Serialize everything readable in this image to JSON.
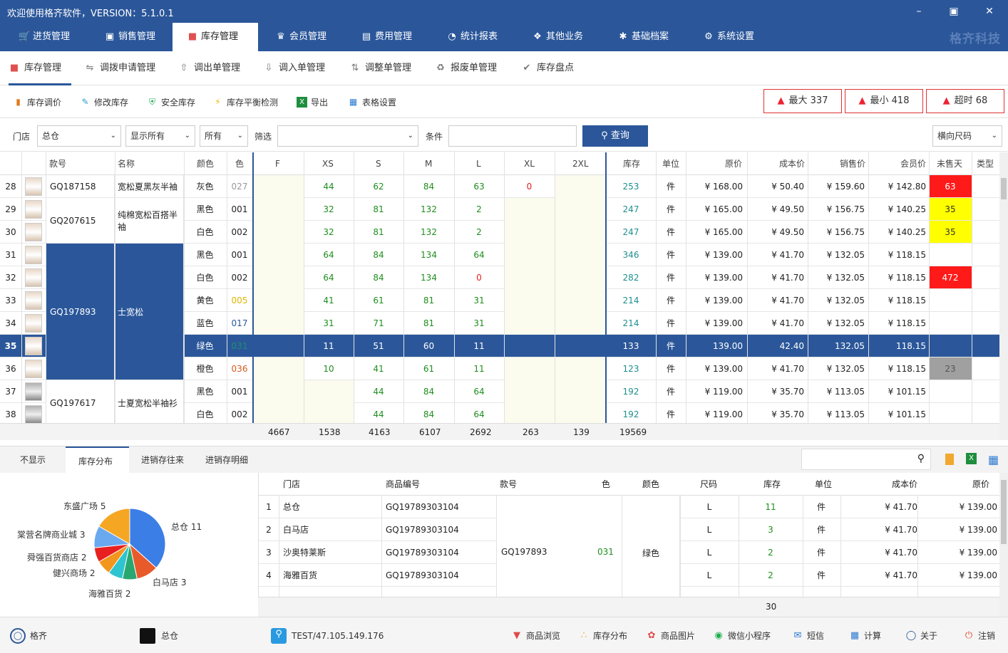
{
  "titlebar": {
    "title": "欢迎使用格齐软件，VERSION：5.1.0.1"
  },
  "menu": {
    "tabs": [
      {
        "label": "进货管理",
        "icon": "cart-icon"
      },
      {
        "label": "销售管理",
        "icon": "bag-icon"
      },
      {
        "label": "库存管理",
        "icon": "box-icon"
      },
      {
        "label": "会员管理",
        "icon": "crown-icon"
      },
      {
        "label": "费用管理",
        "icon": "wallet-icon"
      },
      {
        "label": "统计报表",
        "icon": "pie-icon"
      },
      {
        "label": "其他业务",
        "icon": "apps-icon"
      },
      {
        "label": "基础档案",
        "icon": "puzzle-icon"
      },
      {
        "label": "系统设置",
        "icon": "gear-icon"
      }
    ],
    "brand": "格齐科技"
  },
  "subnav": {
    "tabs": [
      "库存管理",
      "调拨申请管理",
      "调出单管理",
      "调入单管理",
      "调整单管理",
      "报废单管理",
      "库存盘点"
    ]
  },
  "toolbar": {
    "items": [
      "库存调价",
      "修改库存",
      "安全库存",
      "库存平衡检测",
      "导出",
      "表格设置"
    ]
  },
  "alerts": {
    "max": "最大 337",
    "min": "最小 418",
    "overtime": "超时 68"
  },
  "filters": {
    "store_label": "门店",
    "store": "总仓",
    "display": "显示所有",
    "all": "所有",
    "filter_label": "筛选",
    "filter_value": "",
    "cond_label": "条件",
    "cond_value": "",
    "query": "查询",
    "size_mode": "横向尺码"
  },
  "grid": {
    "headers": [
      "款号",
      "名称",
      "颜色",
      "色",
      "F",
      "XS",
      "S",
      "M",
      "L",
      "XL",
      "2XL",
      "库存",
      "单位",
      "原价",
      "成本价",
      "销售价",
      "会员价",
      "未售天",
      "类型"
    ],
    "rows": [
      {
        "no": "28",
        "color": "灰色",
        "code": "027",
        "code_color": "gray",
        "F": "",
        "XS": "44",
        "S": "62",
        "M": "84",
        "L": "63",
        "XL": "0",
        "XXL": "",
        "stock": "253",
        "unit": "件",
        "orig": "¥ 168.00",
        "cost": "¥ 50.40",
        "sale": "¥ 159.60",
        "member": "¥ 142.80",
        "days": "63",
        "days_bg": "#ff1a1a",
        "days_fg": "#ffffff",
        "thumb": "light"
      },
      {
        "no": "29",
        "color": "黑色",
        "code": "001",
        "code_color": "",
        "F": "",
        "XS": "32",
        "S": "81",
        "M": "132",
        "L": "2",
        "XL": "",
        "XXL": "",
        "stock": "247",
        "unit": "件",
        "orig": "¥ 165.00",
        "cost": "¥ 49.50",
        "sale": "¥ 156.75",
        "member": "¥ 140.25",
        "days": "35",
        "days_bg": "#ffff00",
        "days_fg": "#333333",
        "thumb": "light"
      },
      {
        "no": "30",
        "color": "白色",
        "code": "002",
        "code_color": "",
        "F": "",
        "XS": "32",
        "S": "81",
        "M": "132",
        "L": "2",
        "XL": "",
        "XXL": "",
        "stock": "247",
        "unit": "件",
        "orig": "¥ 165.00",
        "cost": "¥ 49.50",
        "sale": "¥ 156.75",
        "member": "¥ 140.25",
        "days": "35",
        "days_bg": "#ffff00",
        "days_fg": "#333333",
        "thumb": "light"
      },
      {
        "no": "31",
        "color": "黑色",
        "code": "001",
        "code_color": "",
        "F": "",
        "XS": "64",
        "S": "84",
        "M": "134",
        "L": "64",
        "XL": "",
        "XXL": "",
        "stock": "346",
        "unit": "件",
        "orig": "¥ 139.00",
        "cost": "¥ 41.70",
        "sale": "¥ 132.05",
        "member": "¥ 118.15",
        "days": "",
        "days_bg": "",
        "days_fg": "",
        "thumb": "light"
      },
      {
        "no": "32",
        "color": "白色",
        "code": "002",
        "code_color": "",
        "F": "",
        "XS": "64",
        "S": "84",
        "M": "134",
        "L": "0",
        "XL": "",
        "XXL": "",
        "stock": "282",
        "unit": "件",
        "orig": "¥ 139.00",
        "cost": "¥ 41.70",
        "sale": "¥ 132.05",
        "member": "¥ 118.15",
        "days": "472",
        "days_bg": "#ff1a1a",
        "days_fg": "#ffffff",
        "thumb": "light"
      },
      {
        "no": "33",
        "color": "黄色",
        "code": "005",
        "code_color": "yellow",
        "F": "",
        "XS": "41",
        "S": "61",
        "M": "81",
        "L": "31",
        "XL": "",
        "XXL": "",
        "stock": "214",
        "unit": "件",
        "orig": "¥ 139.00",
        "cost": "¥ 41.70",
        "sale": "¥ 132.05",
        "member": "¥ 118.15",
        "days": "",
        "days_bg": "",
        "days_fg": "",
        "thumb": "light"
      },
      {
        "no": "34",
        "color": "蓝色",
        "code": "017",
        "code_color": "blue",
        "F": "",
        "XS": "31",
        "S": "71",
        "M": "81",
        "L": "31",
        "XL": "",
        "XXL": "",
        "stock": "214",
        "unit": "件",
        "orig": "¥ 139.00",
        "cost": "¥ 41.70",
        "sale": "¥ 132.05",
        "member": "¥ 118.15",
        "days": "",
        "days_bg": "",
        "days_fg": "",
        "thumb": "light"
      },
      {
        "no": "35",
        "color": "绿色",
        "code": "031",
        "code_color": "green",
        "F": "",
        "XS": "11",
        "S": "51",
        "M": "60",
        "L": "11",
        "XL": "",
        "XXL": "",
        "stock": "133",
        "unit": "件",
        "orig": "139.00",
        "cost": "42.40",
        "sale": "132.05",
        "member": "118.15",
        "days": "",
        "days_bg": "",
        "days_fg": "",
        "thumb": "light"
      },
      {
        "no": "36",
        "color": "橙色",
        "code": "036",
        "code_color": "orange",
        "F": "",
        "XS": "10",
        "S": "41",
        "M": "61",
        "L": "11",
        "XL": "",
        "XXL": "",
        "stock": "123",
        "unit": "件",
        "orig": "¥ 139.00",
        "cost": "¥ 41.70",
        "sale": "¥ 132.05",
        "member": "¥ 118.15",
        "days": "23",
        "days_bg": "#a0a0a0",
        "days_fg": "#555555",
        "thumb": "light"
      },
      {
        "no": "37",
        "color": "黑色",
        "code": "001",
        "code_color": "",
        "F": "",
        "XS": "",
        "S": "44",
        "M": "84",
        "L": "64",
        "XL": "",
        "XXL": "",
        "stock": "192",
        "unit": "件",
        "orig": "¥ 119.00",
        "cost": "¥ 35.70",
        "sale": "¥ 113.05",
        "member": "¥ 101.15",
        "days": "",
        "days_bg": "",
        "days_fg": "",
        "thumb": "dark"
      },
      {
        "no": "38",
        "color": "白色",
        "code": "002",
        "code_color": "",
        "F": "",
        "XS": "",
        "S": "44",
        "M": "84",
        "L": "64",
        "XL": "",
        "XXL": "",
        "stock": "192",
        "unit": "件",
        "orig": "¥ 119.00",
        "cost": "¥ 35.70",
        "sale": "¥ 113.05",
        "member": "¥ 101.15",
        "days": "",
        "days_bg": "",
        "days_fg": "",
        "thumb": "dark"
      }
    ],
    "merged": [
      {
        "style": "GQ187158",
        "name": "宽松夏黑灰半袖",
        "rows": [
          28,
          28
        ]
      },
      {
        "style": "GQ207615",
        "name": "纯棉宽松百搭半袖",
        "rows": [
          29,
          30
        ]
      },
      {
        "style": "GQ197893",
        "name": "士宽松",
        "rows": [
          31,
          36
        ]
      },
      {
        "style": "GQ197617",
        "name": "士夏宽松半袖衫",
        "rows": [
          37,
          38
        ]
      }
    ],
    "totals": {
      "F": "4667",
      "XS": "1538",
      "S": "4163",
      "M": "6107",
      "L": "2692",
      "XL": "263",
      "XXL": "139",
      "stock": "19569"
    }
  },
  "bottom": {
    "tabs": [
      "不显示",
      "库存分布",
      "进销存往来",
      "进销存明细"
    ],
    "search_value": "",
    "table": {
      "headers": [
        "门店",
        "商品编号",
        "款号",
        "色",
        "颜色",
        "尺码",
        "库存",
        "单位",
        "成本价",
        "原价"
      ],
      "rows": [
        {
          "no": "1",
          "store": "总仓",
          "sku": "GQ19789303104",
          "size": "L",
          "stock": "11",
          "unit": "件",
          "cost": "¥ 41.70",
          "orig": "¥ 139.00"
        },
        {
          "no": "2",
          "store": "白马店",
          "sku": "GQ19789303104",
          "size": "L",
          "stock": "3",
          "unit": "件",
          "cost": "¥ 41.70",
          "orig": "¥ 139.00"
        },
        {
          "no": "3",
          "store": "沙奥特莱斯",
          "sku": "GQ19789303104",
          "size": "L",
          "stock": "2",
          "unit": "件",
          "cost": "¥ 41.70",
          "orig": "¥ 139.00"
        },
        {
          "no": "4",
          "store": "海雅百货",
          "sku": "GQ19789303104",
          "size": "L",
          "stock": "2",
          "unit": "件",
          "cost": "¥ 41.70",
          "orig": "¥ 139.00"
        }
      ],
      "merged": {
        "style": "GQ197893",
        "code": "031",
        "color": "绿色"
      },
      "total_stock": "30"
    }
  },
  "chart_data": {
    "type": "pie",
    "slices": [
      {
        "label": "总仓",
        "value": 11,
        "color": "#3b7ee6"
      },
      {
        "label": "白马店",
        "value": 3,
        "color": "#e85a2a"
      },
      {
        "label": "海雅百货",
        "value": 2,
        "color": "#28a870"
      },
      {
        "label": "健兴商场",
        "value": 2,
        "color": "#2ec4d0"
      },
      {
        "label": "舜强百货商店",
        "value": 2,
        "color": "#f2961e"
      },
      {
        "label": "",
        "value": 2,
        "color": "#e82020"
      },
      {
        "label": "棠营名牌商业城",
        "value": 3,
        "color": "#6aa8f0"
      },
      {
        "label": "东盛广场",
        "value": 5,
        "color": "#f5a623"
      }
    ],
    "labels_text": [
      "总仓 11",
      "白马店 3",
      "海雅百货 2",
      "健兴商场 2",
      "舜强百货商店 2",
      "棠营名牌商业城 3",
      "东盛广场 5"
    ]
  },
  "status": {
    "user": "格齐",
    "store": "总仓",
    "server": "TEST/47.105.149.176",
    "items": [
      "商品浏览",
      "库存分布",
      "商品图片",
      "微信小程序",
      "短信",
      "计算",
      "关于",
      "注销"
    ]
  }
}
